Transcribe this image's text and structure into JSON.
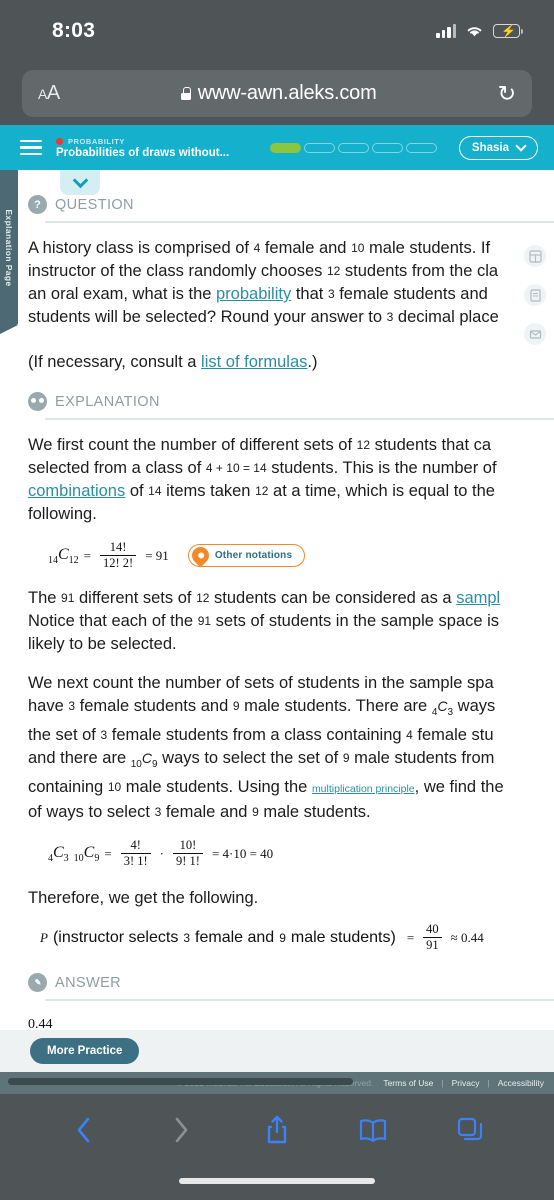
{
  "status_bar": {
    "time": "8:03",
    "signal_icon": "cellular-bars-icon",
    "wifi_icon": "wifi-icon",
    "battery_icon": "battery-charging-icon"
  },
  "browser": {
    "text_size_small": "A",
    "text_size_large": "A",
    "lock_icon": "lock-icon",
    "url": "www-awn.aleks.com",
    "reload_icon": "reload-icon",
    "back_icon": "chevron-left-icon",
    "forward_icon": "chevron-right-icon",
    "share_icon": "share-icon",
    "bookmarks_icon": "book-icon",
    "tabs_icon": "tabs-icon"
  },
  "aleks_header": {
    "menu_icon": "hamburger-menu-icon",
    "category": "PROBABILITY",
    "topic": "Probabilities of draws without...",
    "progress_segments": [
      true,
      false,
      false,
      false,
      false
    ],
    "user_name": "Shasia",
    "user_chevron_icon": "chevron-down-icon",
    "accent_teal": "#14b0cc",
    "progress_green": "#8cc63f",
    "category_dot": "#ee3a2c"
  },
  "side_tab": {
    "label": "Explanation Page",
    "color": "#4d6a74"
  },
  "collapse_tab": {
    "icon": "chevron-down-icon"
  },
  "question": {
    "section_icon": "question-mark-circle-icon",
    "section_title": "QUESTION",
    "lines": [
      {
        "pre": "A history class is comprised of ",
        "n1": "4",
        "mid": " female and ",
        "n2": "10",
        "post": " male students. If"
      },
      {
        "pre": "instructor of the class randomly chooses ",
        "n1": "12",
        "post": " students from the cla"
      },
      {
        "pre": "an oral exam, what is the ",
        "link": "probability",
        "mid": " that ",
        "n1": "3",
        "post": " female students and"
      },
      {
        "pre": "students will be selected? Round your answer to ",
        "n1": "3",
        "post": " decimal place"
      }
    ],
    "consult_pre": "(If necessary, consult a ",
    "consult_link": "list of formulas",
    "consult_post": ".)"
  },
  "explanation": {
    "section_icon": "explanation-circle-icon",
    "section_title": "EXPLANATION",
    "p1_lines": [
      {
        "pre": "We first count the number of different sets of ",
        "n1": "12",
        "post": " students that ca"
      },
      {
        "pre": "selected from a class of ",
        "n1": "4 + 10 = 14",
        "post": " students. This is the number of"
      },
      {
        "link": "combinations",
        "mid": " of ",
        "n1": "14",
        "mid2": " items taken ",
        "n2": "12",
        "post": " at a time, which is equal to the"
      },
      {
        "pre": "following."
      }
    ],
    "formula1": {
      "lhs_base": "C",
      "lhs_presub": "14",
      "lhs_postsub": "12",
      "eq1": "=",
      "numerator": "14!",
      "denominator": "12! 2!",
      "eq2": "= 91",
      "pin_icon": "map-pin-icon",
      "pill_label": "Other notations"
    },
    "p2_lines": [
      {
        "pre": "The ",
        "n1": "91",
        "mid": " different sets of ",
        "n2": "12",
        "mid2": " students can be considered as a ",
        "link": "sampl"
      },
      {
        "pre": "Notice that each of the ",
        "n1": "91",
        "post": " sets of students in the sample space is"
      },
      {
        "pre": "likely to be selected."
      }
    ],
    "p3_lines": [
      {
        "pre": "We next count the number of sets of students in the sample spa"
      },
      {
        "pre": "have ",
        "n1": "3",
        "mid": " female students and ",
        "n2": "9",
        "post": " male students. There are ",
        "math": "4C3",
        "tail": " ways"
      },
      {
        "pre": "the set of ",
        "n1": "3",
        "mid": " female students from a class containing ",
        "n2": "4",
        "post": " female stu"
      },
      {
        "pre": "and there are ",
        "math": "10C9",
        "mid": " ways to select the set of ",
        "n1": "9",
        "post": " male students from"
      },
      {
        "pre": "containing ",
        "n1": "10",
        "mid": " male students. Using the ",
        "smlink": "multiplication principle",
        "post": ", we find the"
      },
      {
        "pre": "of ways to select ",
        "n1": "3",
        "mid": " female and ",
        "n2": "9",
        "post": " male students."
      }
    ],
    "formula2": {
      "lhs1_pre": "4",
      "lhs1_base": "C",
      "lhs1_post": "3",
      "lhs2_pre": "10",
      "lhs2_base": "C",
      "lhs2_post": "9",
      "eq1": "=",
      "f1_num": "4!",
      "f1_den": "3! 1!",
      "dot": "·",
      "f2_num": "10!",
      "f2_den": "9! 1!",
      "eq2": "= 4·10 = 40"
    },
    "therefore": "Therefore, we get the following.",
    "formula3": {
      "p": "P",
      "statement_pre": "(instructor selects ",
      "n1": "3",
      "statement_mid": " female and ",
      "n2": "9",
      "statement_post": " male students)",
      "eq": "=",
      "num": "40",
      "den": "91",
      "approx": "≈ 0.44"
    }
  },
  "answer": {
    "section_icon": "answer-circle-icon",
    "section_title": "ANSWER",
    "value": "0.44"
  },
  "tool_rail": [
    {
      "icon": "calculator-icon"
    },
    {
      "icon": "notes-page-icon"
    },
    {
      "icon": "envelope-icon"
    }
  ],
  "footer": {
    "more_practice_label": "More Practice",
    "copyright": "© 2021 McGraw Hill Education. All Rights Reserved.",
    "terms_label": "Terms of Use",
    "privacy_label": "Privacy",
    "accessibility_label": "Accessibility"
  }
}
